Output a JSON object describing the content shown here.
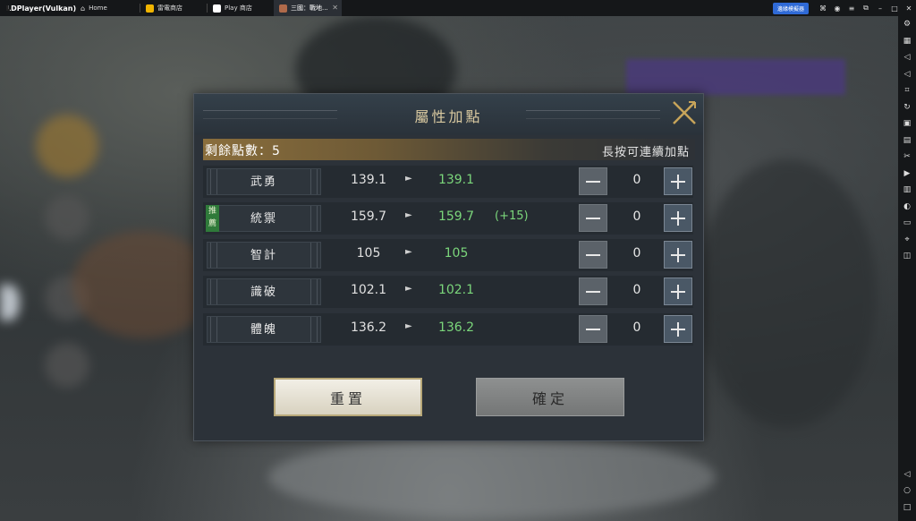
{
  "titlebar": {
    "app_name": "LDPlayer(Vulkan)",
    "tabs": [
      {
        "label": "Home",
        "icon": "home-icon"
      },
      {
        "label": "雷電商店",
        "icon": "store-icon"
      },
      {
        "label": "Play 商店",
        "icon": "play-store-icon"
      },
      {
        "label": "三國：戰地...",
        "icon": "game-icon"
      }
    ],
    "boost_label": "邊緣模擬器"
  },
  "dialog": {
    "title": "屬性加點",
    "remaining_label": "剩餘點數：5",
    "hold_hint": "長按可連續加點",
    "recommend_label": "推薦",
    "arrow": "►",
    "attributes": [
      {
        "name": "武勇",
        "current": "139.1",
        "new": "139.1",
        "bonus": "",
        "count": "0"
      },
      {
        "name": "統禦",
        "current": "159.7",
        "new": "159.7",
        "bonus": "(+15)",
        "count": "0"
      },
      {
        "name": "智計",
        "current": "105",
        "new": "105",
        "bonus": "",
        "count": "0"
      },
      {
        "name": "識破",
        "current": "102.1",
        "new": "102.1",
        "bonus": "",
        "count": "0"
      },
      {
        "name": "體魄",
        "current": "136.2",
        "new": "136.2",
        "bonus": "",
        "count": "0"
      }
    ],
    "reset_label": "重置",
    "confirm_label": "確定"
  },
  "colors": {
    "increase_green": "#7bd67b",
    "title_gold": "#d9c9a0",
    "recommend_green": "#2f7a3a"
  }
}
